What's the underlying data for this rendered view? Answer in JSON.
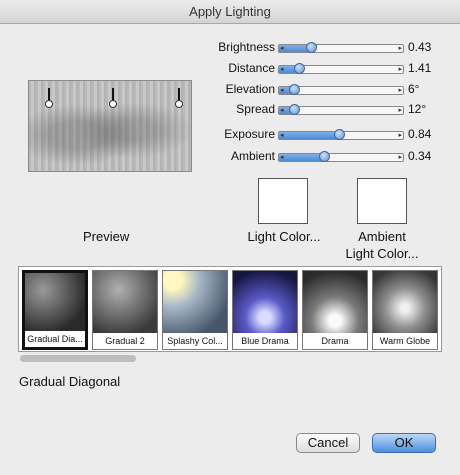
{
  "window": {
    "title": "Apply Lighting"
  },
  "sliders": [
    {
      "label": "Brightness",
      "value": "0.43",
      "level": 0.26
    },
    {
      "label": "Distance",
      "value": "1.41",
      "level": 0.16
    },
    {
      "label": "Elevation",
      "value": "6°",
      "level": 0.12
    },
    {
      "label": "Spread",
      "value": "12°",
      "level": 0.12
    },
    {
      "label": "Exposure",
      "value": "0.84",
      "level": 0.48
    },
    {
      "label": "Ambient",
      "value": "0.34",
      "level": 0.36
    }
  ],
  "preview": {
    "label": "Preview"
  },
  "swatches": {
    "light": {
      "label": "Light Color...",
      "color": "#ffffff"
    },
    "ambient": {
      "label": "Ambient\nLight Color...",
      "color": "#ffffff"
    }
  },
  "presets": [
    {
      "name": "Gradual Dia...",
      "selected": true
    },
    {
      "name": "Gradual 2",
      "selected": false
    },
    {
      "name": "Splashy Col...",
      "selected": false
    },
    {
      "name": "Blue Drama",
      "selected": false
    },
    {
      "name": "Drama",
      "selected": false
    },
    {
      "name": "Warm Globe",
      "selected": false
    }
  ],
  "selected_preset": "Gradual Diagonal",
  "buttons": {
    "cancel": "Cancel",
    "ok": "OK"
  },
  "colors": {
    "accent": "#4d8fdc",
    "slider_fill": "#6aa0e2"
  }
}
